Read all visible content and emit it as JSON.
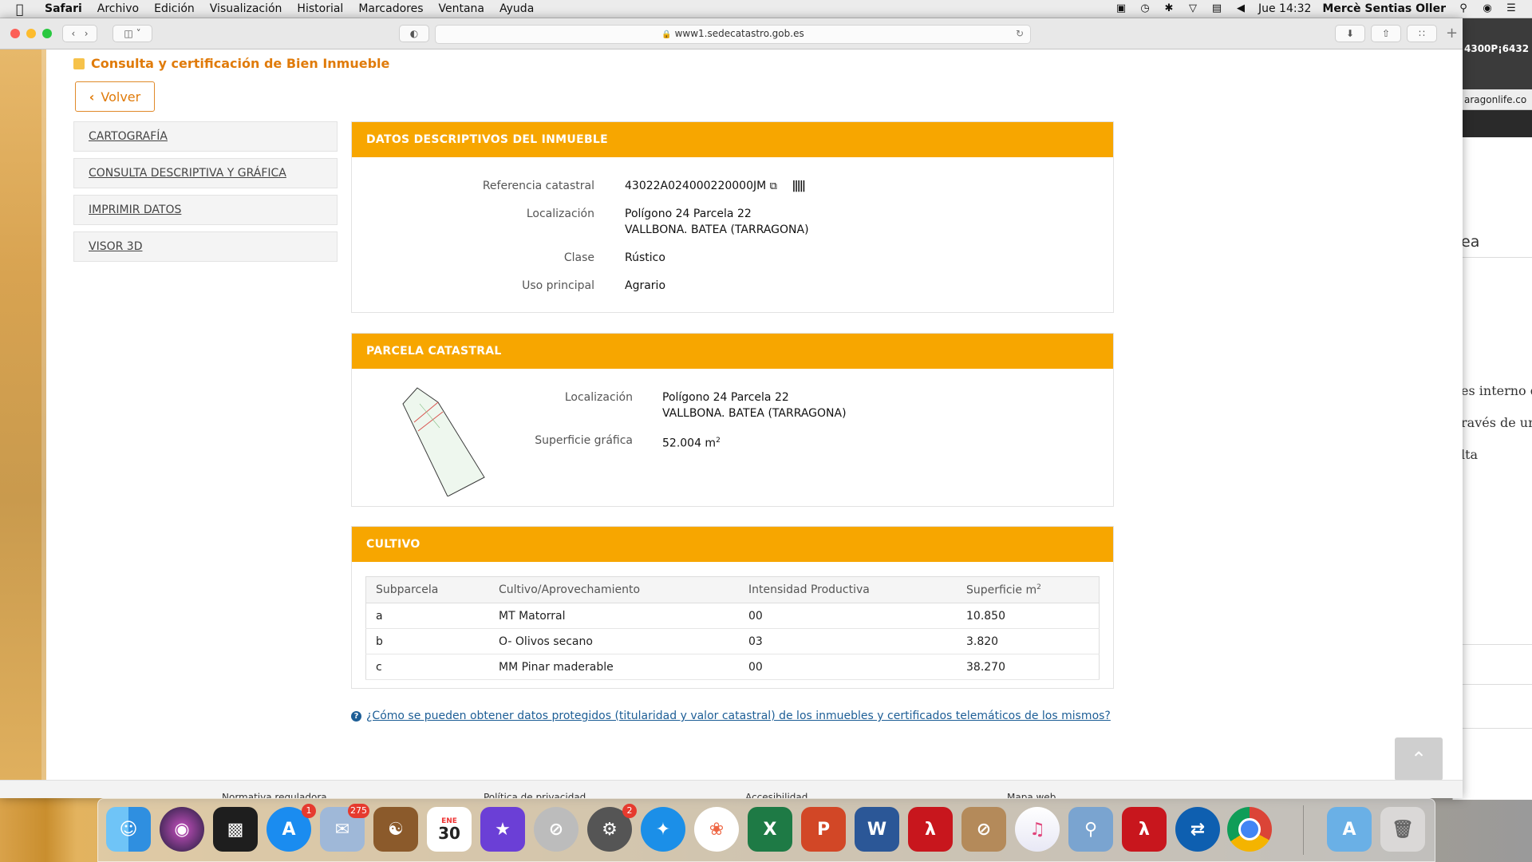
{
  "menubar": {
    "app": "Safari",
    "items": [
      "Archivo",
      "Edición",
      "Visualización",
      "Historial",
      "Marcadores",
      "Ventana",
      "Ayuda"
    ],
    "clock": "Jue 14:32",
    "user": "Mercè Sentias Oller"
  },
  "browser": {
    "url": "www1.sedecatastro.gob.es"
  },
  "right_window": {
    "code": "4300P¡6432",
    "tab": "aragonlife.co",
    "texts": [
      "ea",
      "es interno de",
      "ravés de un",
      "lta"
    ]
  },
  "page": {
    "breadcrumb": "Consulta y certificación de Bien Inmueble",
    "back_label": "Volver",
    "nav": [
      "CARTOGRAFÍA",
      "CONSULTA DESCRIPTIVA Y GRÁFICA",
      "IMPRIMIR DATOS",
      "VISOR 3D"
    ],
    "descriptive": {
      "title": "DATOS DESCRIPTIVOS DEL INMUEBLE",
      "ref_label": "Referencia catastral",
      "ref_value": "43022A024000220000JM",
      "loc_label": "Localización",
      "loc_line1": "Polígono 24 Parcela 22",
      "loc_line2": "VALLBONA. BATEA (TARRAGONA)",
      "class_label": "Clase",
      "class_value": "Rústico",
      "use_label": "Uso principal",
      "use_value": "Agrario"
    },
    "parcel": {
      "title": "PARCELA CATASTRAL",
      "loc_label": "Localización",
      "loc_line1": "Polígono 24 Parcela 22",
      "loc_line2": "VALLBONA. BATEA (TARRAGONA)",
      "surface_label": "Superficie gráfica",
      "surface_value": "52.004 m",
      "surface_unit_sup": "2"
    },
    "crop": {
      "title": "CULTIVO",
      "headers": [
        "Subparcela",
        "Cultivo/Aprovechamiento",
        "Intensidad Productiva",
        "Superficie m"
      ],
      "header_sup": "2",
      "rows": [
        [
          "a",
          "MT Matorral",
          "00",
          "10.850"
        ],
        [
          "b",
          "O- Olivos secano",
          "03",
          "3.820"
        ],
        [
          "c",
          "MM Pinar maderable",
          "00",
          "38.270"
        ]
      ]
    },
    "help_link": "¿Cómo se pueden obtener datos protegidos (titularidad y valor catastral) de los inmuebles y certificados telemáticos de los mismos?",
    "footer": [
      "Normativa reguladora",
      "Política de privacidad",
      "Accesibilidad",
      "Mapa web"
    ]
  },
  "dock": {
    "badges": {
      "appstore": "1",
      "mail": "275",
      "settings": "2"
    },
    "calendar": {
      "month": "ENE",
      "day": "30"
    }
  },
  "colors": {
    "accent": "#f7a600",
    "brand_text": "#e07b0a",
    "link": "#1d5e96"
  }
}
